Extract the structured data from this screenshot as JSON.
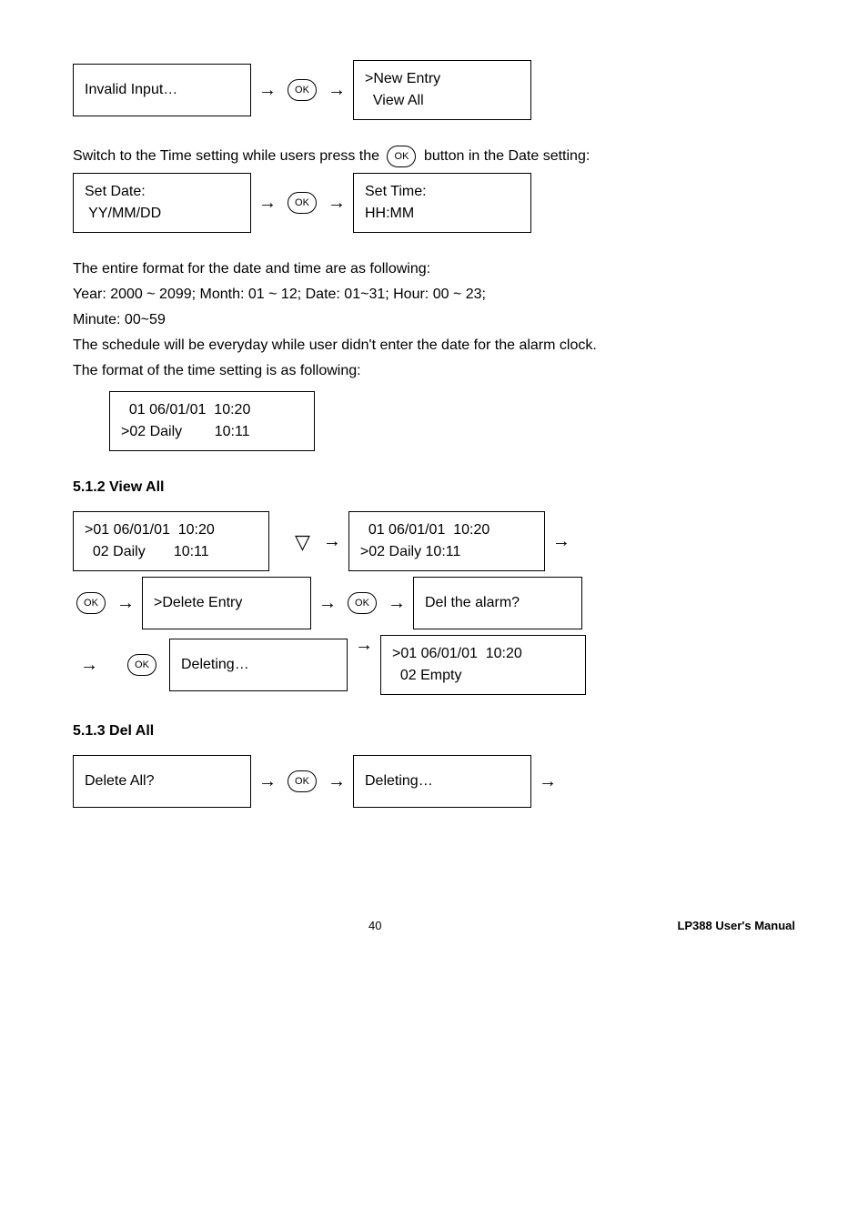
{
  "row1": {
    "box1_line1": "Invalid Input…",
    "ok": "OK",
    "box2_line1": ">New Entry",
    "box2_line2": "  View All"
  },
  "switch_text_a": "Switch to the Time setting while users press the ",
  "switch_text_b": "  button in the Date setting:",
  "row2": {
    "box1_line1": "Set Date:",
    "box1_line2": " YY/MM/DD",
    "box2_line1": "Set Time:",
    "box2_line2": "HH:MM"
  },
  "body": {
    "l1": "The entire format for the date and time are as following:",
    "l2": "Year: 2000 ~ 2099; Month: 01 ~ 12; Date: 01~31; Hour: 00 ~ 23;",
    "l3": "Minute: 00~59",
    "l4": "The schedule will be everyday while user didn't enter the date for the alarm clock.",
    "l5": "The format of the time setting is as following:"
  },
  "fmtbox": {
    "l1": "  01 06/01/01  10:20",
    "l2": ">02 Daily        10:11"
  },
  "sec512": "5.1.2  View All",
  "va": {
    "b1_l1": ">01 06/01/01  10:20",
    "b1_l2": "  02 Daily       10:11",
    "b2_l1": "  01 06/01/01  10:20",
    "b2_l2": ">02 Daily 10:11",
    "b3": ">Delete Entry",
    "b4": "Del the alarm?",
    "b5": "Deleting…",
    "b6_l1": ">01 06/01/01  10:20",
    "b6_l2": "  02 Empty"
  },
  "sec513": "5.1.3  Del All",
  "da": {
    "b1": "Delete All?",
    "b2": "Deleting…"
  },
  "footer": {
    "page": "40",
    "title": "LP388  User's  Manual"
  }
}
